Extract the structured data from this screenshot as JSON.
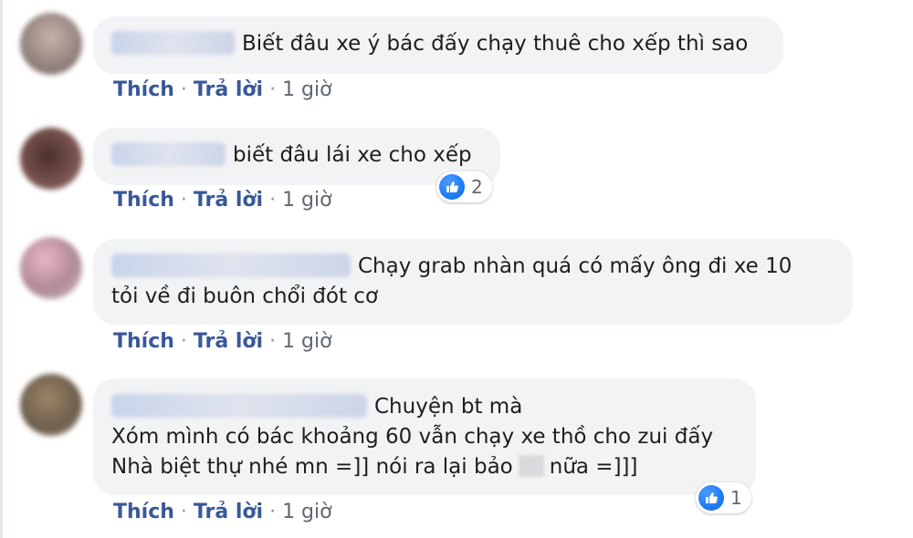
{
  "actions": {
    "like": "Thích",
    "reply": "Trả lời",
    "separator": "·"
  },
  "like_icon": "thumbs-up-icon",
  "colors": {
    "bubble": "#f2f3f5",
    "link": "#385898",
    "like_blue": "#1877f2"
  },
  "comments": [
    {
      "lines": [
        "Biết đâu xe ý bác đấy chạy thuê cho xếp thì sao"
      ],
      "time": "1 giờ",
      "reactions": null
    },
    {
      "lines": [
        "biết đâu lái xe cho xếp"
      ],
      "time": "1 giờ",
      "reactions": "2"
    },
    {
      "lines": [
        "Chạy grab nhàn quá có mấy ông đi xe 10",
        "tỏi về đi buôn chổi đót cơ"
      ],
      "time": "1 giờ",
      "reactions": null
    },
    {
      "lines": [
        "Chuyện bt mà",
        "Xóm mình có bác khoảng 60 vẫn chạy xe thồ cho zui đấy",
        "Nhà biệt thự nhé mn =]] nói ra lại bảo",
        "nữa =]]]"
      ],
      "time": "1 giờ",
      "reactions": "1"
    }
  ]
}
